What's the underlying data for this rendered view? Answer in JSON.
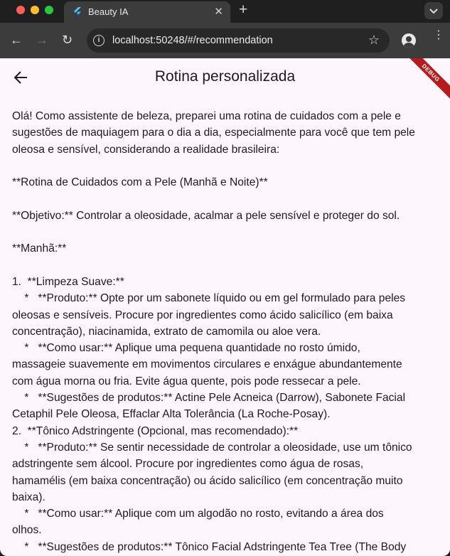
{
  "browser": {
    "tab_title": "Beauty IA",
    "tab_close": "✕",
    "new_tab": "+",
    "url": "localhost:50248/#/recommendation",
    "back": "←",
    "forward": "→",
    "reload": "↻",
    "star": "☆",
    "menu": "⋮"
  },
  "app": {
    "title": "Rotina personalizada",
    "debug_label": "DEBUG",
    "lines": [
      "Olá! Como assistente de beleza, preparei uma rotina de cuidados com a pele e",
      "sugestões de maquiagem para o dia a dia, especialmente para você que tem pele",
      "oleosa e sensível, considerando a realidade brasileira:",
      "",
      "**Rotina de Cuidados com a Pele (Manhã e Noite)**",
      "",
      "**Objetivo:** Controlar a oleosidade, acalmar a pele sensível e proteger do sol.",
      "",
      "**Manhã:**",
      "",
      "1.  **Limpeza Suave:**",
      "    *   **Produto:** Opte por um sabonete líquido ou em gel formulado para peles",
      "oleosas e sensíveis. Procure por ingredientes como ácido salicílico (em baixa",
      "concentração), niacinamida, extrato de camomila ou aloe vera.",
      "    *   **Como usar:** Aplique uma pequena quantidade no rosto úmido,",
      "massageie suavemente em movimentos circulares e enxágue abundantemente",
      "com água morna ou fria. Evite água quente, pois pode ressecar a pele.",
      "    *   **Sugestões de produtos:** Actine Pele Acneica (Darrow), Sabonete Facial",
      "Cetaphil Pele Oleosa, Effaclar Alta Tolerância (La Roche-Posay).",
      "2.  **Tônico Adstringente (Opcional, mas recomendado):**",
      "    *   **Produto:** Se sentir necessidade de controlar a oleosidade, use um tônico",
      "adstringente sem álcool. Procure por ingredientes como água de rosas,",
      "hamamélis (em baixa concentração) ou ácido salicílico (em concentração muito",
      "baixa).",
      "    *   **Como usar:** Aplique com um algodão no rosto, evitando a área dos",
      "olhos.",
      "    *   **Sugestões de produtos:** Tônico Facial Adstringente Tea Tree (The Body"
    ]
  }
}
